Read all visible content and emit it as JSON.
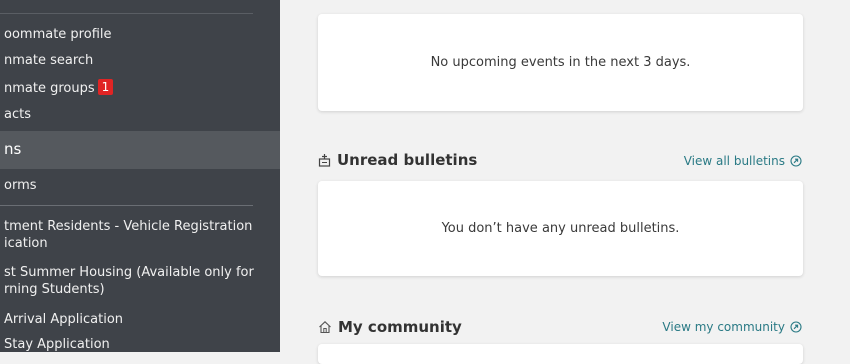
{
  "sidebar": {
    "items": [
      {
        "label": "oommate profile"
      },
      {
        "label": "nmate search"
      },
      {
        "label": "nmate groups",
        "badge": "1"
      },
      {
        "label": "acts"
      }
    ],
    "section": {
      "label": "ns"
    },
    "forms_label": "orms",
    "applications": [
      {
        "line1": "tment Residents - Vehicle Registration",
        "line2": "ication"
      },
      {
        "line1": "st Summer Housing (Available only for",
        "line2": "rning Students)"
      },
      {
        "line1": "Arrival Application"
      },
      {
        "line1": "Stay Application"
      }
    ]
  },
  "events": {
    "empty_text": "No upcoming events in the next 3 days."
  },
  "bulletins": {
    "title": "Unread bulletins",
    "link": "View all bulletins",
    "empty_text": "You don’t have any unread bulletins."
  },
  "community": {
    "title": "My community",
    "link": "View my community"
  },
  "colors": {
    "sidebar_bg": "#3f4349",
    "sidebar_section_bg": "#55595e",
    "badge": "#e02424",
    "link": "#2a7a85",
    "page_bg": "#f2f2f2"
  }
}
